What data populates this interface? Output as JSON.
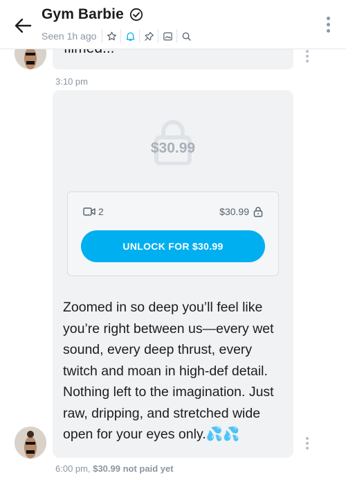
{
  "header": {
    "name": "Gym Barbie",
    "seen": "Seen 1h ago",
    "toolbar_icons": [
      "star-icon",
      "bell-icon",
      "pin-icon",
      "image-icon",
      "search-icon"
    ],
    "accent": "#00aff0"
  },
  "messages": {
    "previous_text": "filmed...",
    "previous_time": "3:10 pm",
    "ppv": {
      "price_overlay": "$30.99",
      "media_count": "2",
      "price": "$30.99",
      "unlock_label": "UNLOCK FOR $30.99"
    },
    "text": "Zoomed in so deep you’ll feel like you’re right between us—every wet sound, every deep thrust, every twitch and moan in high-def detail. Nothing left to the imagination. Just raw, dripping, and stretched wide open for your eyes only.💦💦",
    "time": "6:00 pm,",
    "price_status": "$30.99 not paid yet"
  }
}
